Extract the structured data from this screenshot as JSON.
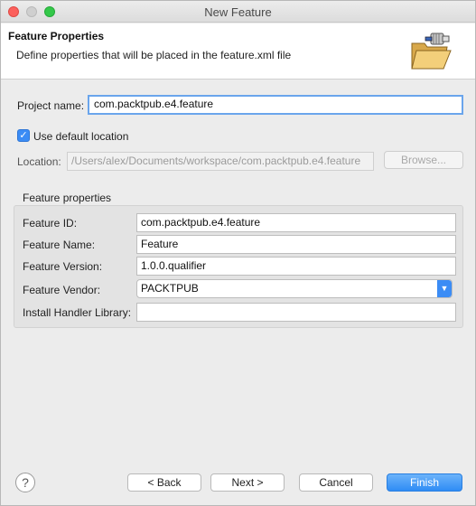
{
  "window": {
    "title": "New Feature"
  },
  "banner": {
    "title": "Feature Properties",
    "description": "Define properties that will be placed in the feature.xml file",
    "icon": "folder-plugin-icon"
  },
  "project": {
    "name_label": "Project name:",
    "name_value": "com.packtpub.e4.feature",
    "use_default_label": "Use default location",
    "use_default_checked": true,
    "location_label": "Location:",
    "location_value": "/Users/alex/Documents/workspace/com.packtpub.e4.feature",
    "browse_label": "Browse..."
  },
  "feature_properties": {
    "group_title": "Feature properties",
    "id_label": "Feature ID:",
    "id_value": "com.packtpub.e4.feature",
    "name_label": "Feature Name:",
    "name_value": "Feature",
    "version_label": "Feature Version:",
    "version_value": "1.0.0.qualifier",
    "vendor_label": "Feature Vendor:",
    "vendor_value": "PACKTPUB",
    "handler_label": "Install Handler Library:",
    "handler_value": ""
  },
  "buttons": {
    "help": "?",
    "back": "< Back",
    "next": "Next >",
    "cancel": "Cancel",
    "finish": "Finish"
  },
  "colors": {
    "accent": "#3b8cf5",
    "focus_ring": "#6aa5ec"
  }
}
